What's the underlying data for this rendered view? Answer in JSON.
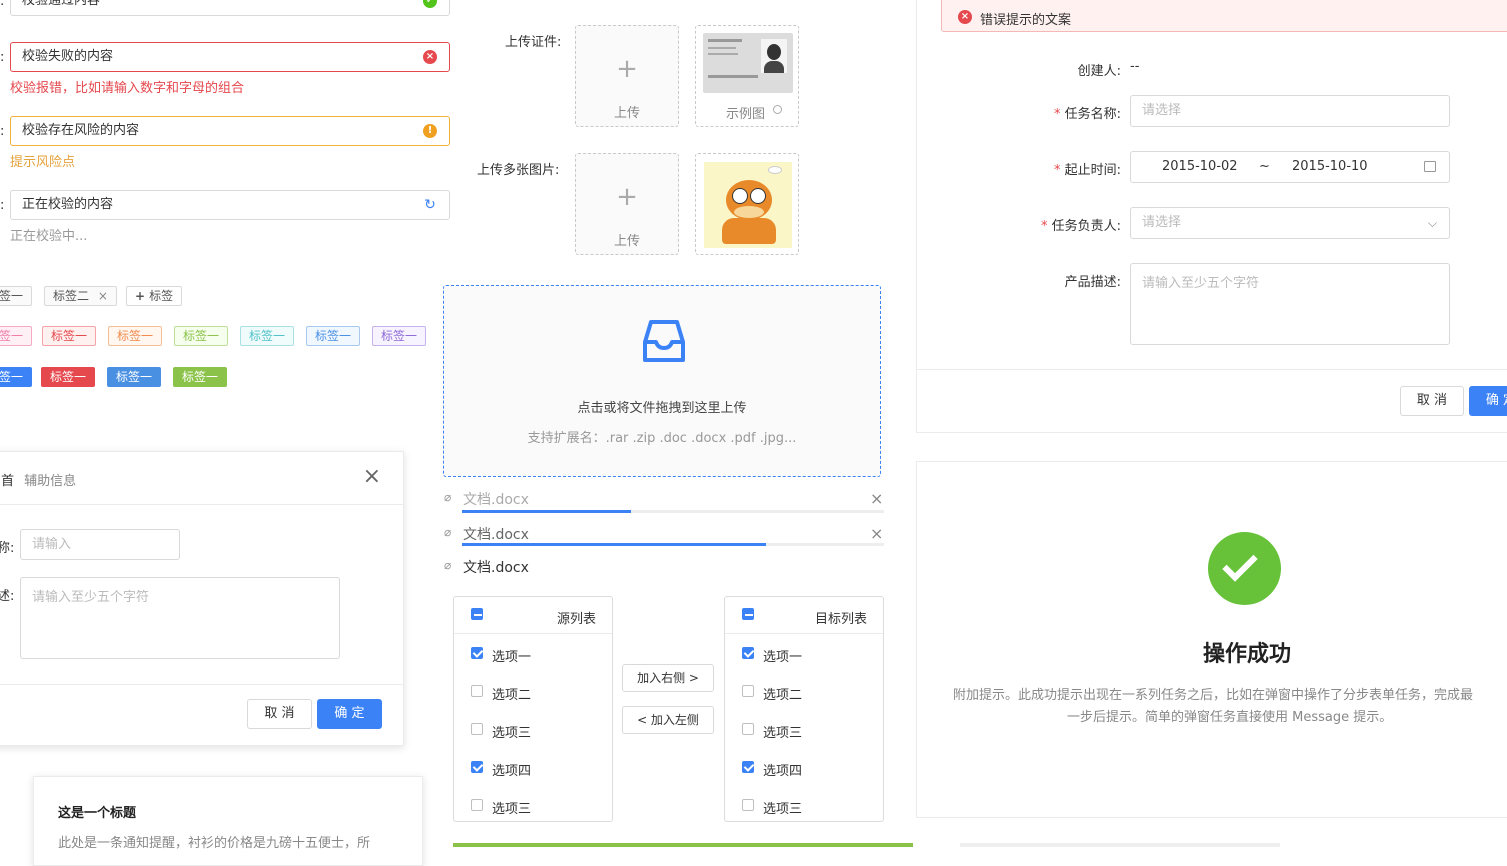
{
  "validation": {
    "success_value": "校验通过内容",
    "error_value": "校验失败的内容",
    "error_msg": "校验报错，比如请输入数字和字母的组合",
    "warn_value": "校验存在风险的内容",
    "warn_msg": "提示风险点",
    "loading_value": "正在校验的内容",
    "loading_msg": "正在校验中...",
    "colon": ":"
  },
  "tags": {
    "row1": [
      "签一",
      "标签二",
      "标签"
    ],
    "row1_add_icon": "plus-icon",
    "row2": [
      "签一",
      "标签一",
      "标签一",
      "标签一",
      "标签一",
      "标签一",
      "标签一"
    ],
    "row3": [
      "签一",
      "标签一",
      "标签一",
      "标签一"
    ],
    "colors": {
      "red": "#e5484d",
      "orange": "#f08a4b",
      "green": "#8bc34a",
      "cyan": "#4fc1c9",
      "blue": "#4a90e2",
      "purple": "#8e6bd8",
      "pink": "#f07ca8",
      "filled_red": "#e5484d",
      "filled_blue": "#4a90e2",
      "filled_green": "#8bc34a",
      "filled_dark": "#3b82f6"
    }
  },
  "modal": {
    "title_partial": "首",
    "subtitle": "辅助信息",
    "label1_partial": "称:",
    "input_placeholder": "请输入",
    "label2_partial": "述:",
    "textarea_placeholder": "请输入至少五个字符",
    "cancel": "取 消",
    "confirm": "确 定"
  },
  "notification": {
    "title": "这是一个标题",
    "body": "此处是一条通知提醒，衬衫的价格是九磅十五便士，所"
  },
  "upload": {
    "id_label": "上传证件:",
    "upload_text": "上传",
    "example_text": "示例图",
    "multi_label": "上传多张图片:",
    "drag_text": "点击或将文件拖拽到这里上传",
    "drag_hint": "支持扩展名：.rar .zip .doc .docx .pdf .jpg...",
    "files": [
      {
        "name": "文档.docx",
        "progress": 0.4,
        "state": "uploading"
      },
      {
        "name": "文档.docx",
        "progress": 0.72,
        "state": "uploading"
      },
      {
        "name": "文档.docx",
        "progress": 1.0,
        "state": "done"
      }
    ]
  },
  "transfer": {
    "source_title": "源列表",
    "target_title": "目标列表",
    "add_right": "加入右侧 >",
    "add_left": "< 加入左侧",
    "source_items": [
      {
        "label": "选项一",
        "checked": true
      },
      {
        "label": "选项二",
        "checked": false
      },
      {
        "label": "选项三",
        "checked": false
      },
      {
        "label": "选项四",
        "checked": true
      },
      {
        "label": "选项三",
        "checked": false
      }
    ],
    "target_items": [
      {
        "label": "选项一",
        "checked": true
      },
      {
        "label": "选项二",
        "checked": false
      },
      {
        "label": "选项三",
        "checked": false
      },
      {
        "label": "选项四",
        "checked": true
      },
      {
        "label": "选项三",
        "checked": false
      }
    ]
  },
  "form": {
    "error_alert": "错误提示的文案",
    "creator_label": "创建人:",
    "creator_value": "--",
    "task_name_label": "任务名称:",
    "task_name_placeholder": "请选择",
    "time_label": "起止时间:",
    "start_date": "2015-10-02",
    "range_sep": "~",
    "end_date": "2015-10-10",
    "owner_label": "任务负责人:",
    "owner_placeholder": "请选择",
    "desc_label": "产品描述:",
    "desc_placeholder": "请输入至少五个字符",
    "required_mark": "*",
    "cancel": "取 消",
    "confirm": "确 定"
  },
  "result": {
    "title": "操作成功",
    "desc_line1": "附加提示。此成功提示出现在一系列任务之后，比如在弹窗中操作了分步表单任务，完成最",
    "desc_line2": "一步后提示。简单的弹窗任务直接使用 Message 提示。",
    "success_color": "#67c23a"
  }
}
